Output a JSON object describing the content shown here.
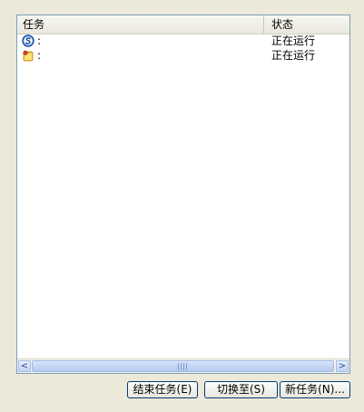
{
  "header": {
    "task_col": "任务",
    "status_col": "状态"
  },
  "tasks": [
    {
      "icon": "sogou-s-icon",
      "name": ":",
      "status": "正在运行"
    },
    {
      "icon": "folder-app-icon",
      "name": ":",
      "status": "正在运行"
    }
  ],
  "scrollbar": {
    "left_arrow": "<",
    "right_arrow": ">"
  },
  "buttons": {
    "end_task": "结束任务(E)",
    "switch_to": "切换至(S)",
    "new_task": "新任务(N)..."
  },
  "colors": {
    "window_bg": "#ece9d8",
    "border": "#7f9db9",
    "scroll_blue": "#b5caef",
    "button_border": "#003c74"
  }
}
